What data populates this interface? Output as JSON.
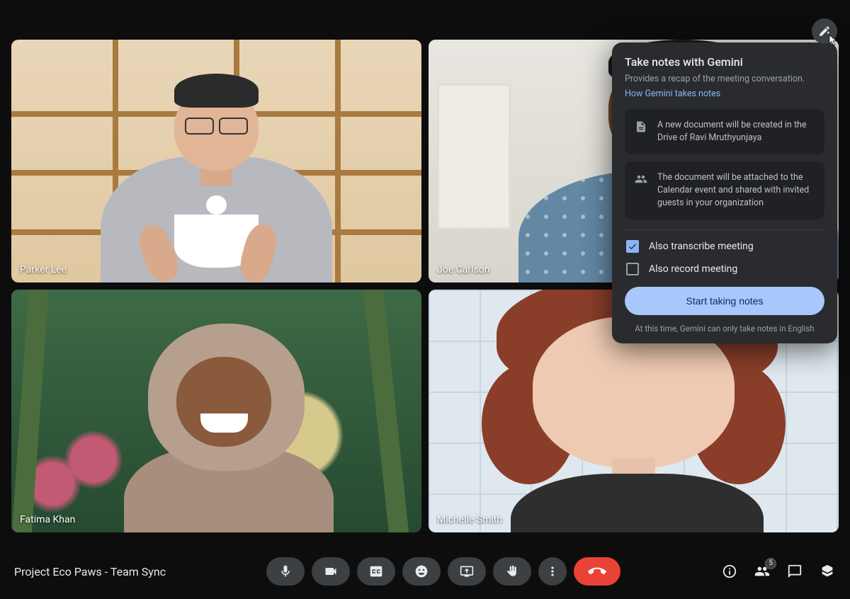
{
  "meeting": {
    "title": "Project Eco Paws - Team Sync"
  },
  "participants": [
    {
      "name": "Parker Lee"
    },
    {
      "name": "Joe Carlson"
    },
    {
      "name": "Fatima Khan"
    },
    {
      "name": "Michelle Smith"
    }
  ],
  "participant_count_badge": "5",
  "gemini_panel": {
    "title": "Take notes with Gemini",
    "subtitle": "Provides a recap of the meeting conversation.",
    "link_text": "How Gemini takes notes",
    "info1": "A new document will be created in the Drive of Ravi Mruthyunjaya",
    "info2": "The document will be attached to the Calendar event and shared with invited guests in your organization",
    "checkbox1_label": "Also transcribe meeting",
    "checkbox1_checked": true,
    "checkbox2_label": "Also record meeting",
    "checkbox2_checked": false,
    "cta_label": "Start taking notes",
    "disclaimer": "At this time, Gemini can only take notes in English"
  },
  "controls": {
    "mic": "microphone",
    "cam": "camera",
    "cc": "captions",
    "emoji": "reactions",
    "present": "present-screen",
    "hand": "raise-hand",
    "more": "more-options",
    "end": "leave-call"
  },
  "right_icons": {
    "info": "meeting-details",
    "people": "people",
    "chat": "chat",
    "activities": "activities"
  }
}
